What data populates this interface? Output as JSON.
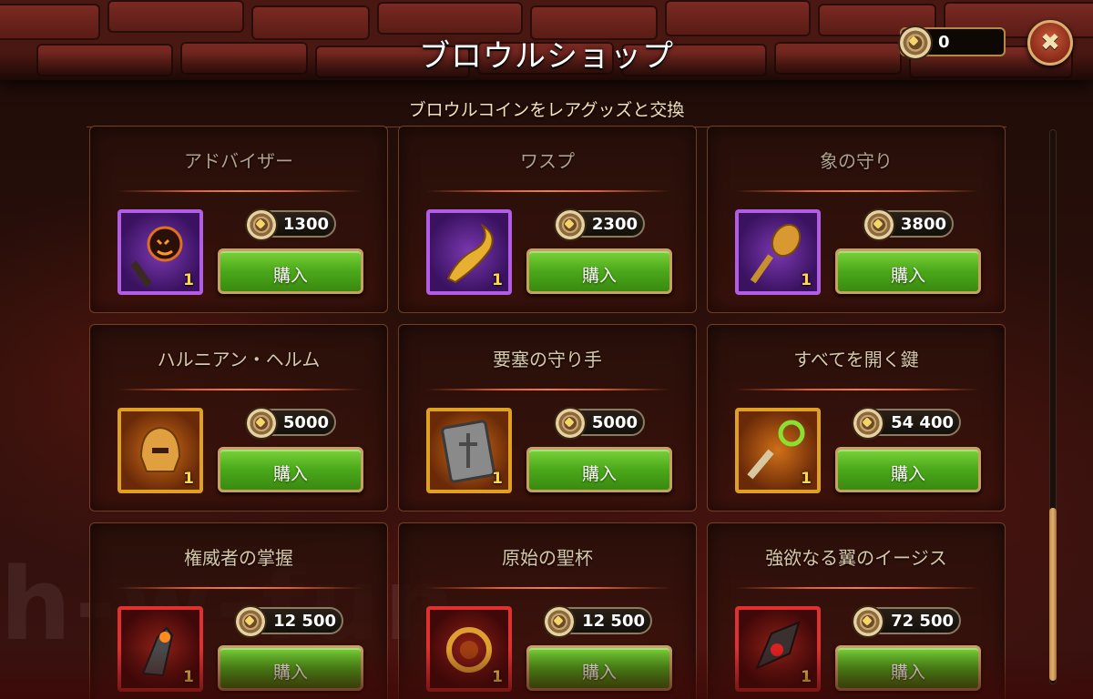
{
  "header": {
    "title": "ブロウルショップ",
    "subtitle": "ブロウルコインをレアグッズと交換",
    "balance": "0"
  },
  "icons": {
    "coin": "brawl-coin-icon",
    "close": "close-icon"
  },
  "items": [
    {
      "name": "アドバイザー",
      "price": "1300",
      "qty": "1",
      "rarity": "purple",
      "buy_label": "購入"
    },
    {
      "name": "ワスプ",
      "price": "2300",
      "qty": "1",
      "rarity": "purple",
      "buy_label": "購入"
    },
    {
      "name": "象の守り",
      "price": "3800",
      "qty": "1",
      "rarity": "purple",
      "buy_label": "購入"
    },
    {
      "name": "ハルニアン・ヘルム",
      "price": "5000",
      "qty": "1",
      "rarity": "gold",
      "buy_label": "購入"
    },
    {
      "name": "要塞の守り手",
      "price": "5000",
      "qty": "1",
      "rarity": "gold",
      "buy_label": "購入"
    },
    {
      "name": "すべてを開く鍵",
      "price": "54 400",
      "qty": "1",
      "rarity": "gold",
      "buy_label": "購入"
    },
    {
      "name": "権威者の掌握",
      "price": "12 500",
      "qty": "1",
      "rarity": "red",
      "buy_label": "購入"
    },
    {
      "name": "原始の聖杯",
      "price": "12 500",
      "qty": "1",
      "rarity": "red",
      "buy_label": "購入"
    },
    {
      "name": "強欲なる翼のイージス",
      "price": "72 500",
      "qty": "1",
      "rarity": "red",
      "buy_label": "購入"
    }
  ],
  "colors": {
    "buy_button": "#4aa81a",
    "purple_frame": "#b35ce6",
    "gold_frame": "#e0a020",
    "red_frame": "#e03030"
  },
  "watermark": "h-w-fun"
}
